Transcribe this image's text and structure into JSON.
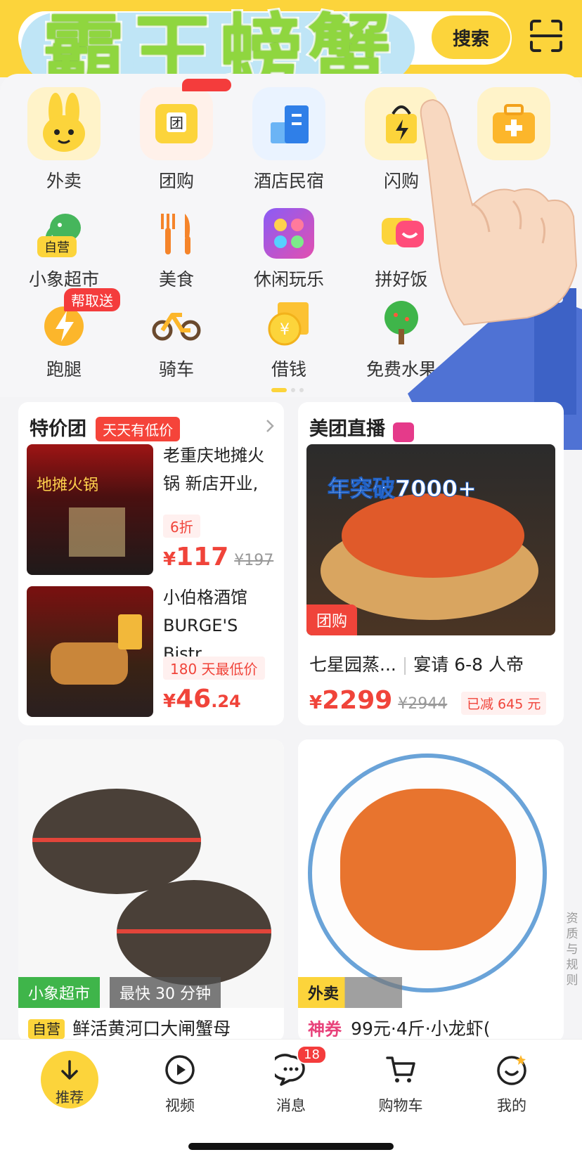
{
  "header": {
    "headline": "霸王螃蟹",
    "search_button": "搜索",
    "scan_icon": "scan-icon"
  },
  "grid": {
    "row1": [
      {
        "label": "外卖",
        "icon": "rabbit-icon"
      },
      {
        "label": "团购",
        "icon": "group-buy-icon"
      },
      {
        "label": "酒店民宿",
        "icon": "hotel-icon"
      },
      {
        "label": "闪购",
        "icon": "flash-bag-icon"
      },
      {
        "label": "",
        "icon": "medicine-kit-icon"
      }
    ],
    "row2": [
      {
        "label": "小象超市",
        "icon": "elephant-icon",
        "tag": "自营"
      },
      {
        "label": "美食",
        "icon": "fork-knife-icon"
      },
      {
        "label": "休闲玩乐",
        "icon": "leisure-icon"
      },
      {
        "label": "拼好饭",
        "icon": "smile-bowl-icon"
      }
    ],
    "row3": [
      {
        "label": "跑腿",
        "icon": "lightning-icon",
        "tag": "帮取送"
      },
      {
        "label": "骑车",
        "icon": "bike-icon"
      },
      {
        "label": "借钱",
        "icon": "yuan-coin-icon"
      },
      {
        "label": "免费水果",
        "icon": "tree-icon"
      }
    ]
  },
  "deals_card": {
    "title": "特价团",
    "tag": "天天有低价",
    "items": [
      {
        "name": "老重庆地摊火锅 新店开业,",
        "discount": "6折",
        "price_int": "117",
        "price_dec": "",
        "orig_price": "¥197"
      },
      {
        "name": "小伯格酒馆 BURGE'S Bistr",
        "discount": "180 天最低价",
        "price_int": "46",
        "price_dec": ".24",
        "orig_price": ""
      }
    ],
    "photo_text": "地摊火锅"
  },
  "live_card": {
    "title": "美团直播",
    "image_overlay": "年突破7000+",
    "badge": "团购",
    "product": "七星园蒸...",
    "product_sub": "宴请 6-8 人帝",
    "price": "2299",
    "orig_price": "¥2944",
    "saved": "已减 645 元"
  },
  "product_cards": [
    {
      "badge_primary": "小象超市",
      "badge_secondary": "最快 30 分钟",
      "self_tag": "自营",
      "name": "鲜活黄河口大闸蟹母"
    },
    {
      "badge_primary": "外卖",
      "coupon": "神券",
      "name": "99元·4斤·小龙虾("
    }
  ],
  "side_note": "资质与规则",
  "bottom_nav": [
    {
      "label": "推荐",
      "icon": "arrow-down-icon"
    },
    {
      "label": "视频",
      "icon": "play-icon"
    },
    {
      "label": "消息",
      "icon": "chat-icon",
      "badge": "18"
    },
    {
      "label": "购物车",
      "icon": "cart-icon"
    },
    {
      "label": "我的",
      "icon": "profile-smile-icon"
    }
  ],
  "currency": "¥",
  "colors": {
    "brand_yellow": "#fcd43b",
    "price_red": "#f0443a",
    "headline_green": "#8fd63f"
  }
}
